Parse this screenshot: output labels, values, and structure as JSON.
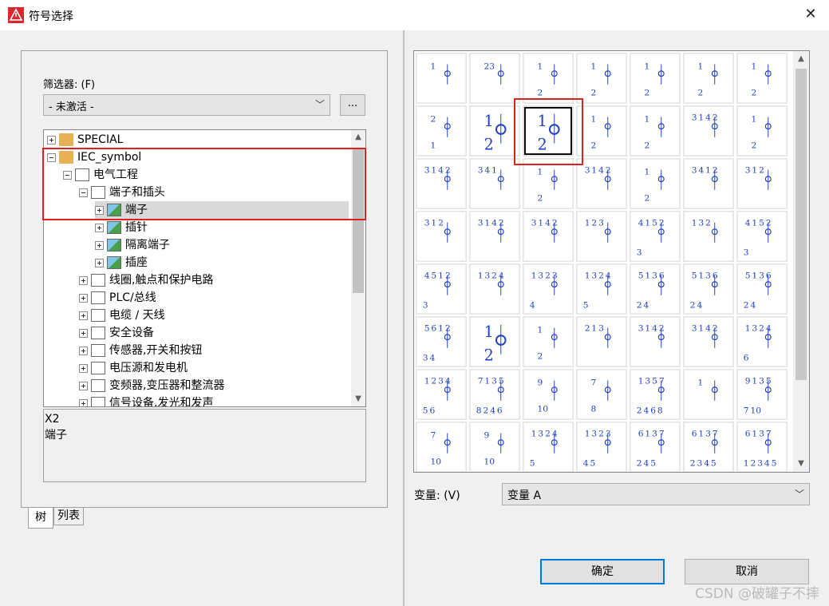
{
  "window": {
    "title": "符号选择",
    "close_glyph": "✕"
  },
  "filter": {
    "label": "筛选器: (F)",
    "value": "- 未激活 -",
    "more_button": "..."
  },
  "tree": {
    "nodes": [
      {
        "label": "SPECIAL",
        "icon": "folder-icon",
        "expander": "plus"
      },
      {
        "label": "IEC_symbol",
        "icon": "folder-icon",
        "expander": "minus"
      },
      {
        "label": "电气工程",
        "icon": "document-icon",
        "expander": "minus"
      },
      {
        "label": "端子和插头",
        "icon": "document-icon",
        "expander": "minus"
      },
      {
        "label": "端子",
        "icon": "image-icon",
        "expander": "plus",
        "selected": true
      },
      {
        "label": "插针",
        "icon": "image-icon",
        "expander": "plus"
      },
      {
        "label": "隔离端子",
        "icon": "image-icon",
        "expander": "plus"
      },
      {
        "label": "插座",
        "icon": "image-icon",
        "expander": "plus"
      },
      {
        "label": "线圈,触点和保护电路",
        "icon": "document-icon",
        "expander": "plus"
      },
      {
        "label": "PLC/总线",
        "icon": "document-icon",
        "expander": "plus"
      },
      {
        "label": "电缆 / 天线",
        "icon": "document-icon",
        "expander": "plus"
      },
      {
        "label": "安全设备",
        "icon": "document-icon",
        "expander": "plus"
      },
      {
        "label": "传感器,开关和按钮",
        "icon": "document-icon",
        "expander": "plus"
      },
      {
        "label": "电压源和发电机",
        "icon": "document-icon",
        "expander": "plus"
      },
      {
        "label": "变频器,变压器和整流器",
        "icon": "document-icon",
        "expander": "plus"
      },
      {
        "label": "信号设备,发光和发声",
        "icon": "document-icon",
        "expander": "plus"
      }
    ]
  },
  "description": {
    "line1": "X2",
    "line2": "端子"
  },
  "tabs": {
    "tree": "树",
    "list": "列表"
  },
  "symbols": {
    "rows": [
      [
        "1",
        "23",
        "1 2",
        "1 2",
        "1 2",
        "1 2",
        "1 2"
      ],
      [
        "2 1",
        "1 2",
        "1 2",
        "1 2",
        "1 2",
        "3 1 4 2",
        "1 2"
      ],
      [
        "3 1 4 2",
        "3 4 1",
        "1 2",
        "3 1 4 2",
        "1 2",
        "3 4 1 2",
        "3 1 2"
      ],
      [
        "3 1 2",
        "3 1 4 2",
        "3 1 4 2",
        "1 2 3",
        "4 1 5 2 3",
        "1 3 2",
        "4 1 5 2 3"
      ],
      [
        "4 5 1 2 3",
        "1 3 2 4",
        "1 3 2 3 4",
        "1 3 2 4 5",
        "5 1 3 6 2 4",
        "5 1 3 6 2 4",
        "5 1 3 6 2 4"
      ],
      [
        "5 6 1 2 3 4",
        "1 2",
        "1 2",
        "2 1 3",
        "3 1 4 2",
        "3 1 4 2",
        "1 3 2 4 6"
      ],
      [
        "1 2 3 4 5 6",
        "7 1 3 5 8 2 4 6",
        "9 10",
        "7 8",
        "1 3 5 7 2 4 6 8",
        "1",
        "9 1 3 5 7 10"
      ],
      [
        "7 10",
        "9 10",
        "1 3 2 4 5",
        "1 3 2 3 4 5",
        "6 1 3 7 2 4 5",
        "6 1 3 7 2 3 4 5",
        "6 1 3 7 1 2 3 4 5"
      ]
    ],
    "selected_index": "row 2, column 3",
    "line_color": "#1f3fbf"
  },
  "variant": {
    "label": "变量: (V)",
    "value": "变量 A"
  },
  "buttons": {
    "ok": "确定",
    "cancel": "取消"
  },
  "watermark": "CSDN @破罐子不摔",
  "colors": {
    "highlight": "#e02020",
    "primary_border": "#0078d7"
  }
}
